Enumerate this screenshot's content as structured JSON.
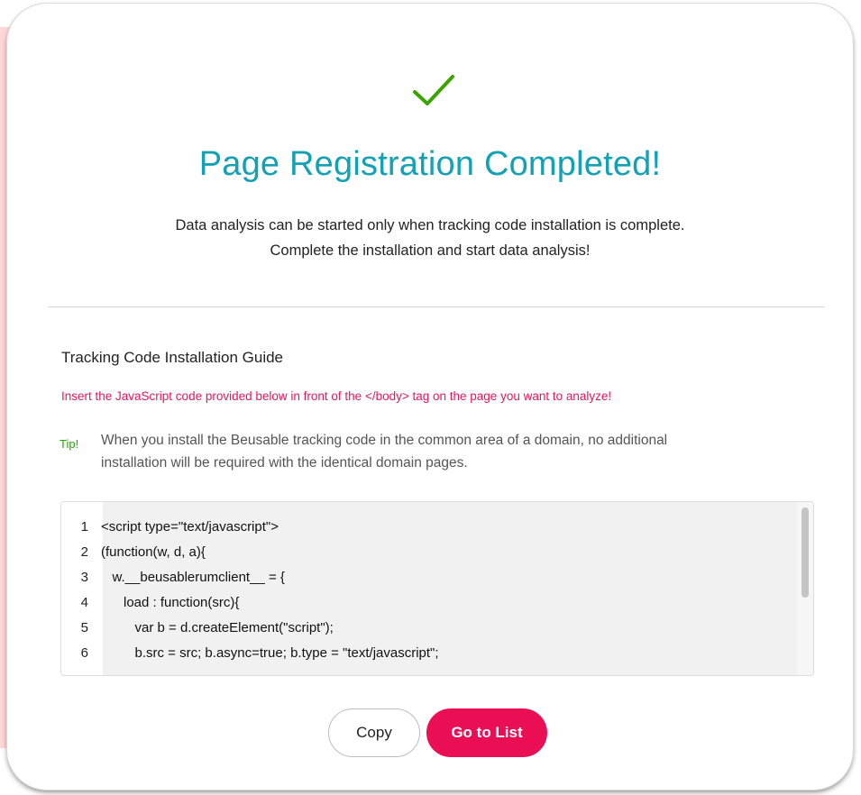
{
  "modal": {
    "title": "Page Registration Completed!",
    "subtitle_line1": "Data analysis can be started only when tracking code installation is complete.",
    "subtitle_line2": "Complete the installation and start data analysis!",
    "success_icon": "checkmark-icon",
    "accent_color": "#13a1b4",
    "check_color": "#3aa400"
  },
  "guide": {
    "heading": "Tracking Code Installation Guide",
    "notice": "Insert the JavaScript code provided below in front of the </body> tag on the page you want to analyze!",
    "notice_color": "#e6175c",
    "tip_label": "Tip!",
    "tip_line1": "When you install the Beusable tracking code in the common area of a domain, no additional",
    "tip_line2": "installation will be required with the identical domain pages."
  },
  "code": {
    "lines": [
      {
        "num": "1",
        "text": "<script type=\"text/javascript\">"
      },
      {
        "num": "2",
        "text": "(function(w, d, a){"
      },
      {
        "num": "3",
        "text": "   w.__beusablerumclient__ = {"
      },
      {
        "num": "4",
        "text": "      load : function(src){"
      },
      {
        "num": "5",
        "text": "         var b = d.createElement(\"script\");"
      },
      {
        "num": "6",
        "text": "         b.src = src; b.async=true; b.type = \"text/javascript\";"
      }
    ]
  },
  "buttons": {
    "copy_label": "Copy",
    "list_label": "Go to List",
    "primary_color": "#ea0f55"
  }
}
